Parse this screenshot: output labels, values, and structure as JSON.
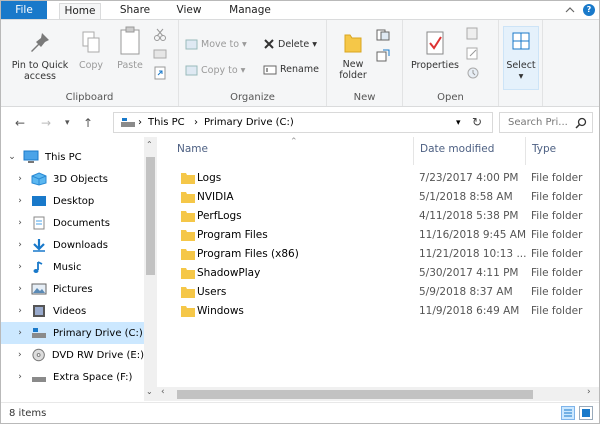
{
  "tabs": [
    "File",
    "Home",
    "Share",
    "View",
    "Manage"
  ],
  "ribbon": {
    "clipboard": {
      "pin": "Pin to Quick access",
      "copy": "Copy",
      "paste": "Paste",
      "label": "Clipboard"
    },
    "organize": {
      "move_to": "Move to",
      "copy_to": "Copy to",
      "delete": "Delete",
      "rename": "Rename",
      "label": "Organize"
    },
    "new": {
      "new_folder": "New folder",
      "label": "New"
    },
    "open": {
      "properties": "Properties",
      "label": "Open"
    },
    "select": {
      "select": "Select"
    }
  },
  "address": {
    "crumbs": [
      "This PC",
      "Primary Drive (C:)"
    ],
    "search_placeholder": "Search Pri..."
  },
  "nav_items": [
    {
      "label": "This PC",
      "icon": "monitor-icon",
      "expanded": true
    },
    {
      "label": "3D Objects",
      "icon": "cube-icon"
    },
    {
      "label": "Desktop",
      "icon": "desktop-icon"
    },
    {
      "label": "Documents",
      "icon": "documents-icon"
    },
    {
      "label": "Downloads",
      "icon": "download-icon"
    },
    {
      "label": "Music",
      "icon": "music-icon"
    },
    {
      "label": "Pictures",
      "icon": "pictures-icon"
    },
    {
      "label": "Videos",
      "icon": "videos-icon"
    },
    {
      "label": "Primary Drive (C:)",
      "icon": "drive-icon",
      "selected": true
    },
    {
      "label": "DVD RW Drive (E:)",
      "icon": "dvd-icon"
    },
    {
      "label": "Extra Space (F:)",
      "icon": "drive-icon"
    }
  ],
  "columns": {
    "name": "Name",
    "date": "Date modified",
    "type": "Type"
  },
  "files": [
    {
      "name": "Logs",
      "date": "7/23/2017 4:00 PM",
      "type": "File folder"
    },
    {
      "name": "NVIDIA",
      "date": "5/1/2018 8:58 AM",
      "type": "File folder"
    },
    {
      "name": "PerfLogs",
      "date": "4/11/2018 5:38 PM",
      "type": "File folder"
    },
    {
      "name": "Program Files",
      "date": "11/16/2018 9:45 AM",
      "type": "File folder"
    },
    {
      "name": "Program Files (x86)",
      "date": "11/21/2018 10:13 ...",
      "type": "File folder"
    },
    {
      "name": "ShadowPlay",
      "date": "5/30/2017 4:11 PM",
      "type": "File folder"
    },
    {
      "name": "Users",
      "date": "5/9/2018 8:37 AM",
      "type": "File folder"
    },
    {
      "name": "Windows",
      "date": "11/9/2018 6:49 AM",
      "type": "File folder"
    }
  ],
  "status": {
    "count": "8 items"
  },
  "colors": {
    "accent": "#1979ca",
    "selection": "#cce8ff",
    "folder": "#f5c748"
  }
}
